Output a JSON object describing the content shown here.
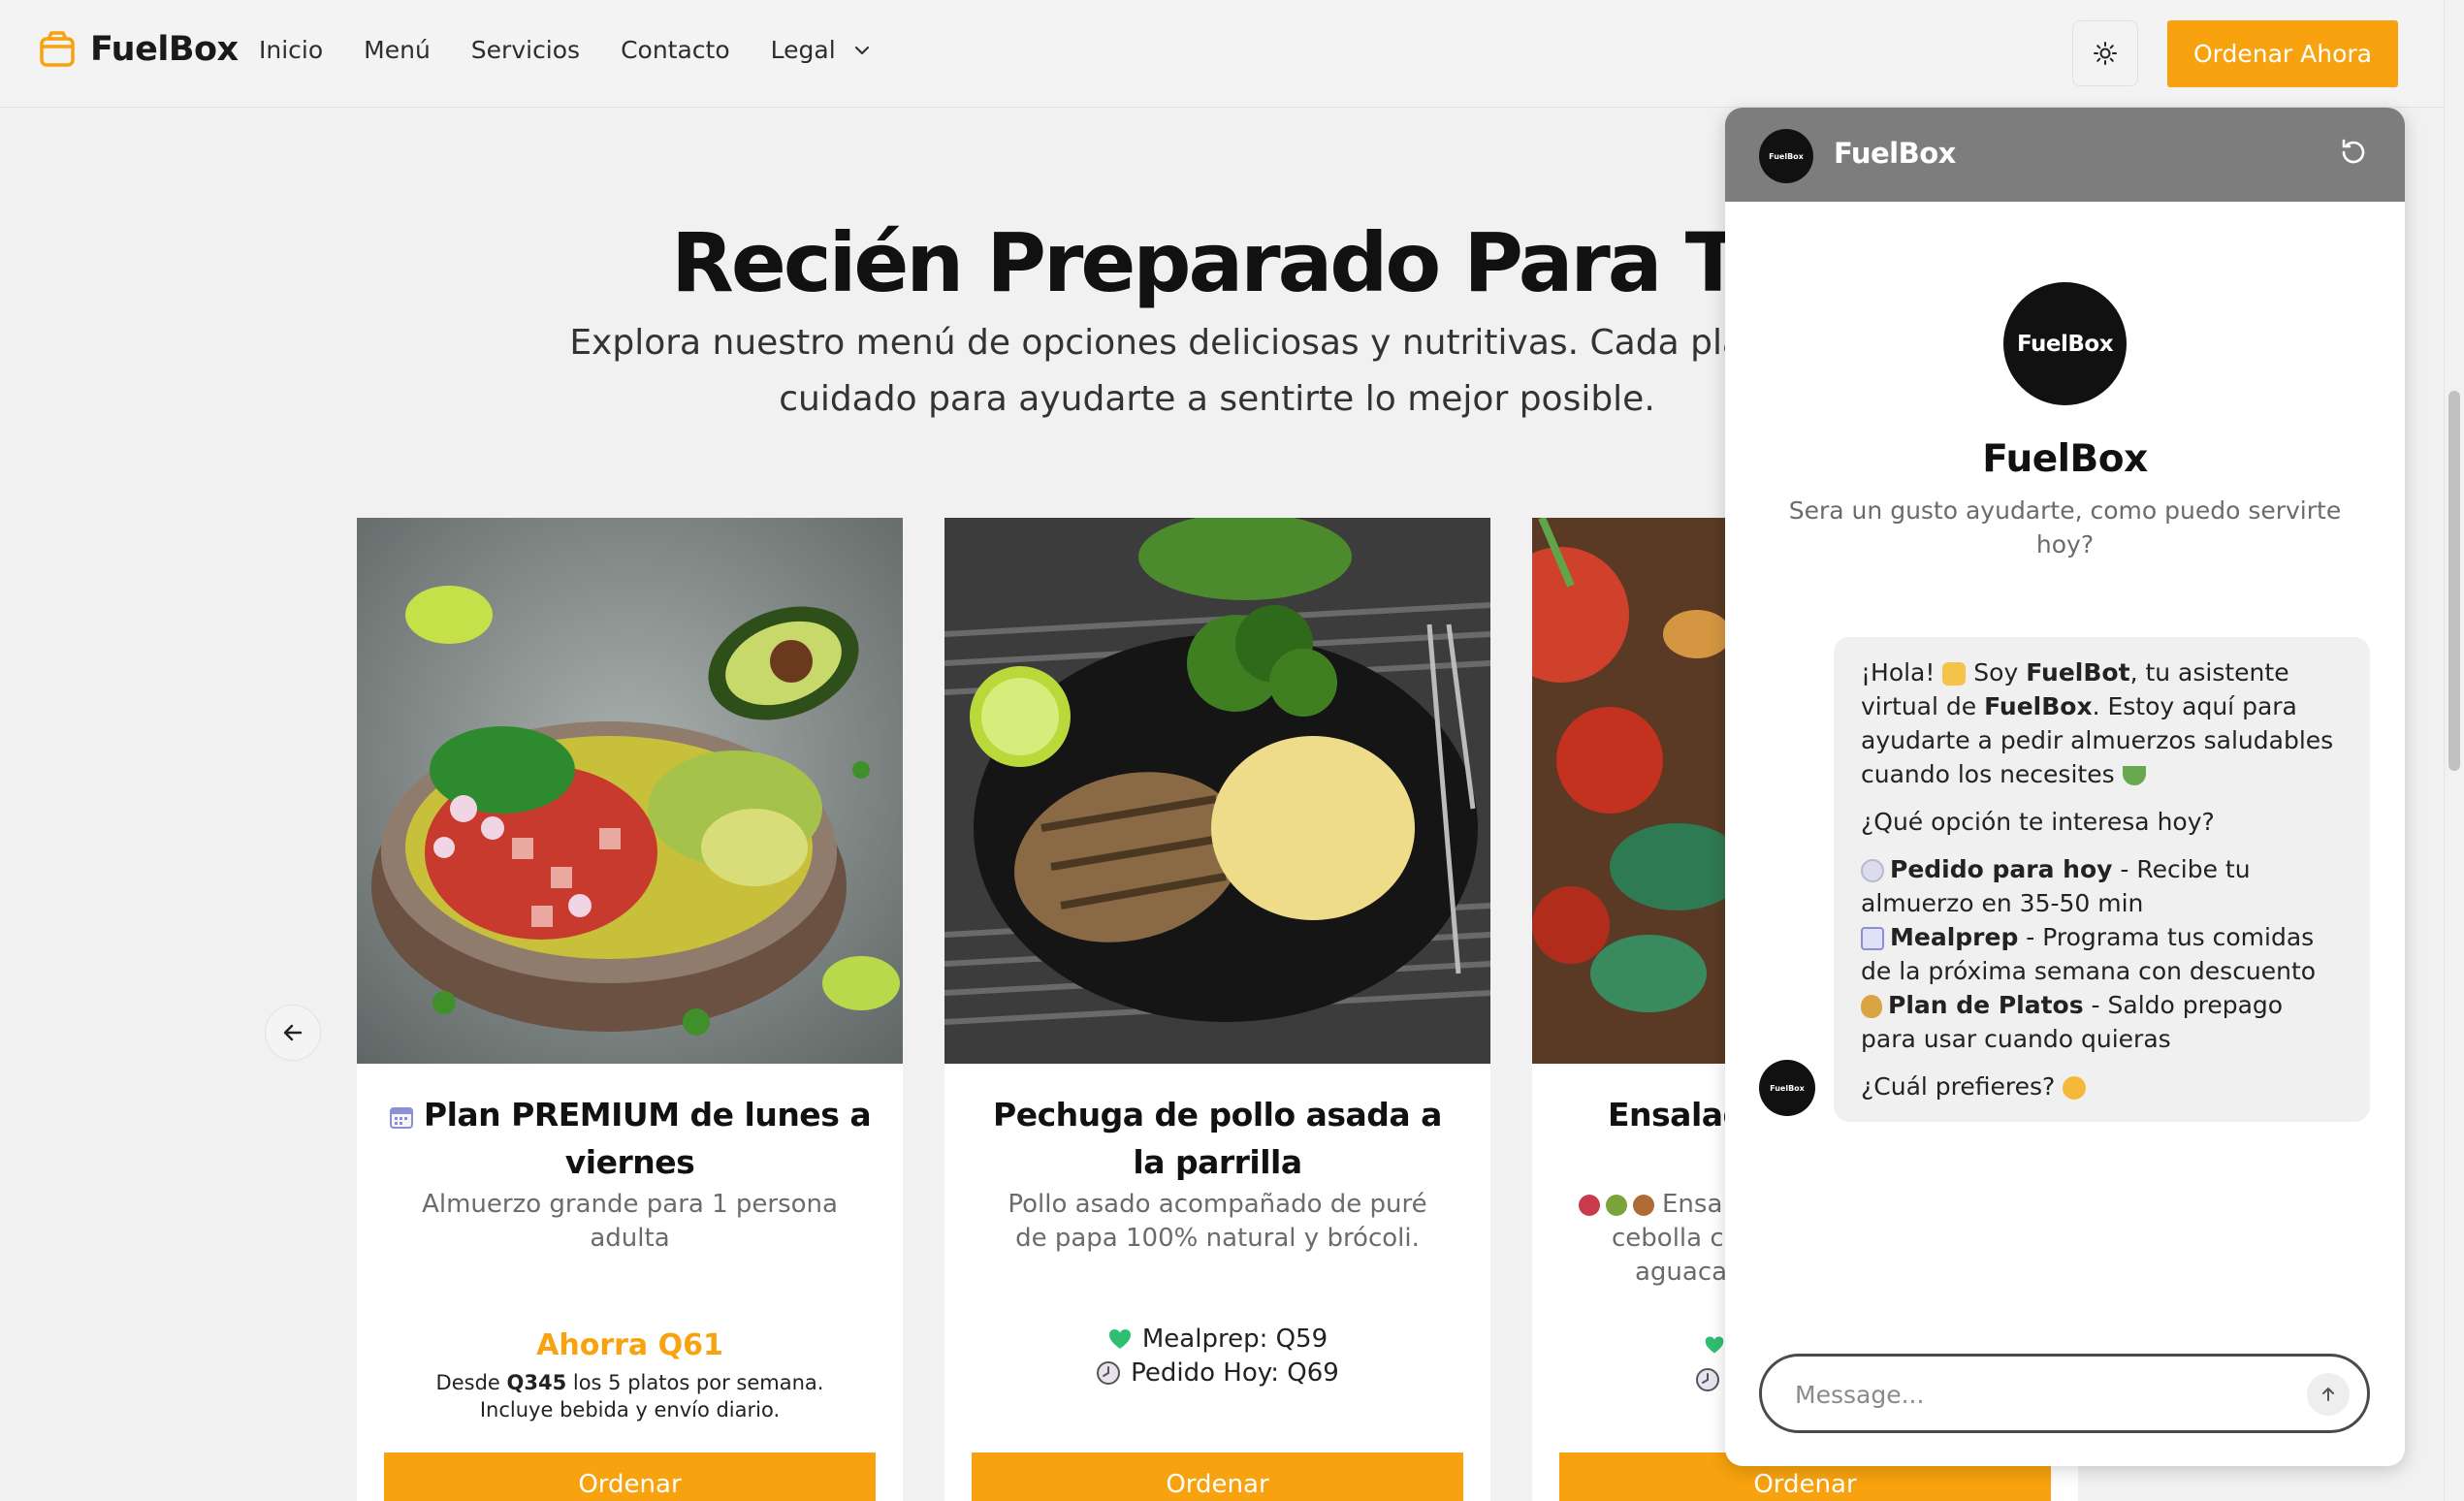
{
  "nav": {
    "brand": "FuelBox",
    "links": [
      "Inicio",
      "Menú",
      "Servicios",
      "Contacto",
      "Legal"
    ],
    "order_button": "Ordenar Ahora",
    "accent_color": "#f7a20e"
  },
  "hero": {
    "title": "Recién Preparado Para Ti",
    "subtitle_line1": "Explora nuestro menú de opciones deliciosas y nutritivas. Cada plato está",
    "subtitle_line2": "cuidado para ayudarte a sentirte lo mejor posible."
  },
  "cards": [
    {
      "title_emoji": "calendar-icon",
      "title": "Plan PREMIUM de lunes a viernes",
      "description": "Almuerzo grande para 1 persona adulta",
      "savings": "Ahorra Q61",
      "fine_pre": "Desde ",
      "fine_price": "Q345",
      "fine_post": " los 5 platos por semana.",
      "fine_line2": "Incluye bebida y envío diario.",
      "button": "Ordenar"
    },
    {
      "title": "Pechuga de pollo asada a la parrilla",
      "description": "Pollo asado acompañado de puré de papa 100% natural y brócoli.",
      "price_mealprep": "Mealprep: Q59",
      "price_today": "Pedido Hoy: Q69",
      "button": "Ordenar"
    },
    {
      "title": "Ensalad",
      "description_line1": "Ensa",
      "description_line2": "cebolla c",
      "description_line3": "aguaca",
      "button": "Ordenar"
    }
  ],
  "chat": {
    "header_title": "FuelBox",
    "avatar_text": "FuelBox",
    "bot_name": "FuelBox",
    "tagline": "Sera un gusto ayudarte, como puedo servirte hoy?",
    "msg": {
      "greet_a": "¡Hola! ",
      "greet_b": " Soy ",
      "greet_bot": "FuelBot",
      "greet_c": ", tu asistente virtual de ",
      "greet_brand": "FuelBox",
      "greet_d": ". Estoy aquí para ayudarte a pedir almuerzos saludables cuando los necesites ",
      "question": "¿Qué opción te interesa hoy?",
      "opt1_title": "Pedido para hoy",
      "opt1_text": " - Recibe tu almuerzo en 35-50 min",
      "opt2_title": "Mealprep",
      "opt2_text": " - Programa tus comidas de la próxima semana con descuento",
      "opt3_title": "Plan de Platos",
      "opt3_text": " - Saldo prepago para usar cuando quieras",
      "closing": "¿Cuál prefieres? "
    },
    "input_placeholder": "Message..."
  }
}
